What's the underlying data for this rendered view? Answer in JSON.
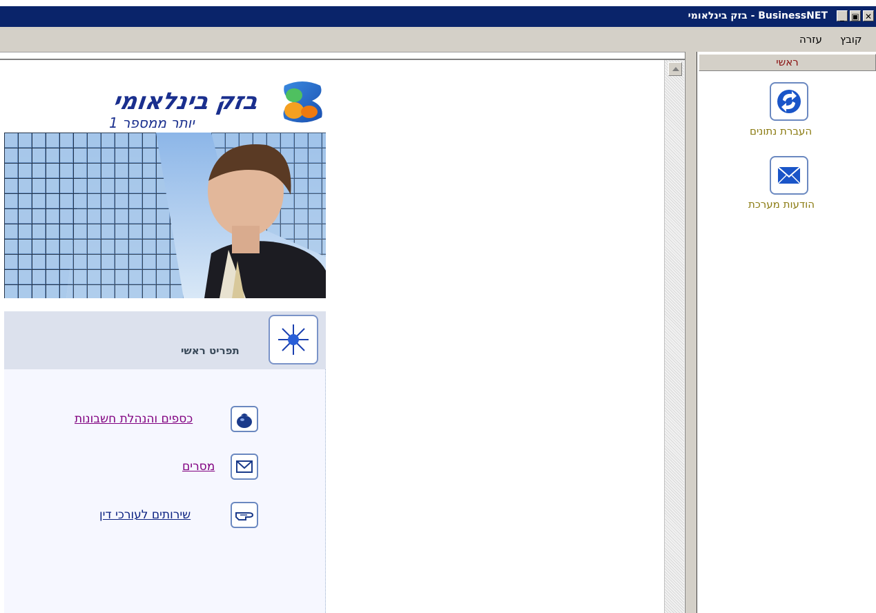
{
  "window": {
    "title": "BusinessNET - בזק בינלאומי",
    "controls": {
      "close": "✕",
      "restore": "🗗",
      "minimize": "_"
    }
  },
  "menubar": {
    "items": [
      {
        "label": "קובץ"
      },
      {
        "label": "עזרה"
      }
    ]
  },
  "brand": {
    "name": "בזק בינלאומי",
    "tagline": "יותר ממספר 1"
  },
  "main_menu": {
    "title": "תפריט ראשי",
    "links": [
      {
        "label": "כספים והנהלת חשבונות",
        "color": "#800080",
        "icon": "money-bag-icon"
      },
      {
        "label": "מסרים",
        "color": "#800080",
        "icon": "envelope-icon"
      },
      {
        "label": "שירותים לעורכי דין",
        "color": "#0a2080",
        "icon": "pointing-hand-icon"
      }
    ]
  },
  "nav": {
    "header": "ראשי",
    "items": [
      {
        "label": "העברת נתונים",
        "icon": "sync-arrows-icon"
      },
      {
        "label": "הודעות מערכת",
        "icon": "envelope-icon"
      }
    ]
  },
  "colors": {
    "titlebar": "#0a246a",
    "menubar": "#d4d0c8",
    "brand_blue": "#1a2f8e",
    "nav_label": "#8a7a10",
    "nav_header_text": "#8a1010"
  }
}
